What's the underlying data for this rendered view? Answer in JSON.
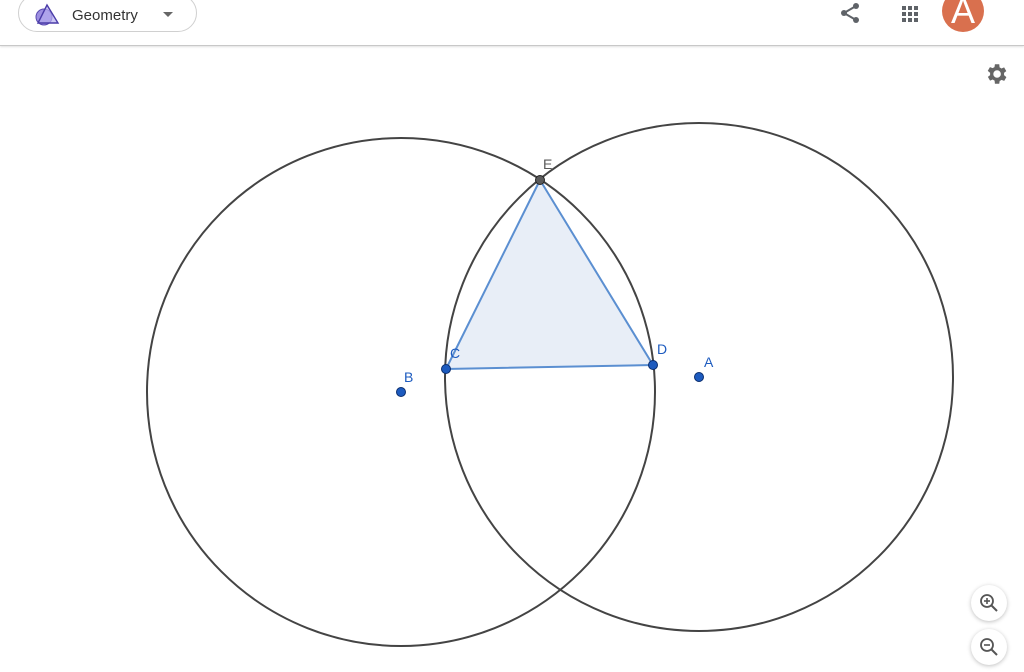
{
  "app": {
    "name": "Geometry",
    "user_initial": "A"
  },
  "colors": {
    "accent": "#1565c0",
    "triangle_stroke": "#5b8fd1",
    "triangle_fill": "#e8eef7",
    "avatar": "#d9704e",
    "point_free": "#1d5bbf",
    "point_dependent": "#5a5a5a"
  },
  "toolbar": {
    "share_icon": "share-icon",
    "apps_icon": "apps-grid-icon",
    "settings_icon": "gear-icon"
  },
  "zoom": {
    "in_icon": "zoom-in-icon",
    "out_icon": "zoom-out-icon"
  },
  "construction": {
    "points": {
      "A": "A",
      "B": "B",
      "C": "C",
      "D": "D",
      "E": "E"
    },
    "objects": [
      "circle-a",
      "circle-b",
      "triangle-cde"
    ]
  }
}
